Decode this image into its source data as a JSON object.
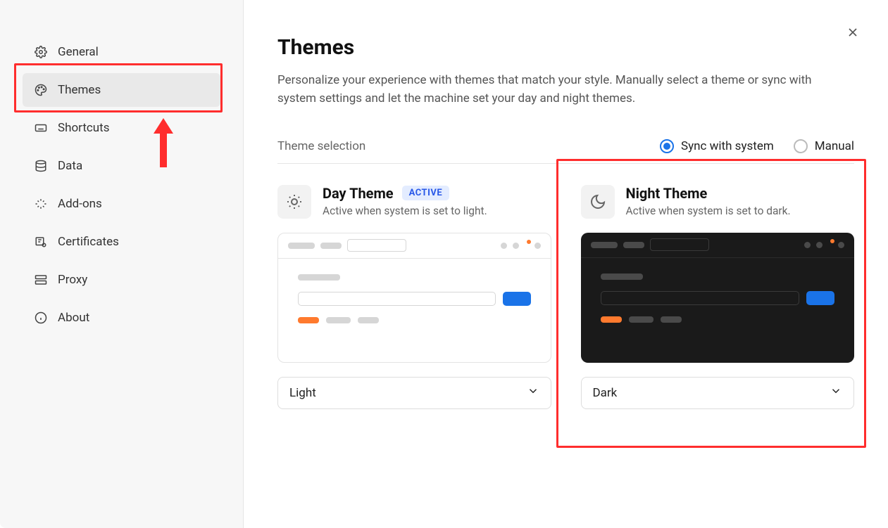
{
  "sidebar": {
    "items": [
      {
        "label": "General"
      },
      {
        "label": "Themes"
      },
      {
        "label": "Shortcuts"
      },
      {
        "label": "Data"
      },
      {
        "label": "Add-ons"
      },
      {
        "label": "Certificates"
      },
      {
        "label": "Proxy"
      },
      {
        "label": "About"
      }
    ]
  },
  "page": {
    "title": "Themes",
    "description": "Personalize your experience with themes that match your style. Manually select a theme or sync with system settings and let the machine set your day and night themes."
  },
  "selection": {
    "label": "Theme selection",
    "options": {
      "sync": "Sync with system",
      "manual": "Manual"
    }
  },
  "day": {
    "title": "Day Theme",
    "badge": "ACTIVE",
    "sub": "Active when system is set to light.",
    "select": "Light"
  },
  "night": {
    "title": "Night Theme",
    "sub": "Active when system is set to dark.",
    "select": "Dark"
  }
}
